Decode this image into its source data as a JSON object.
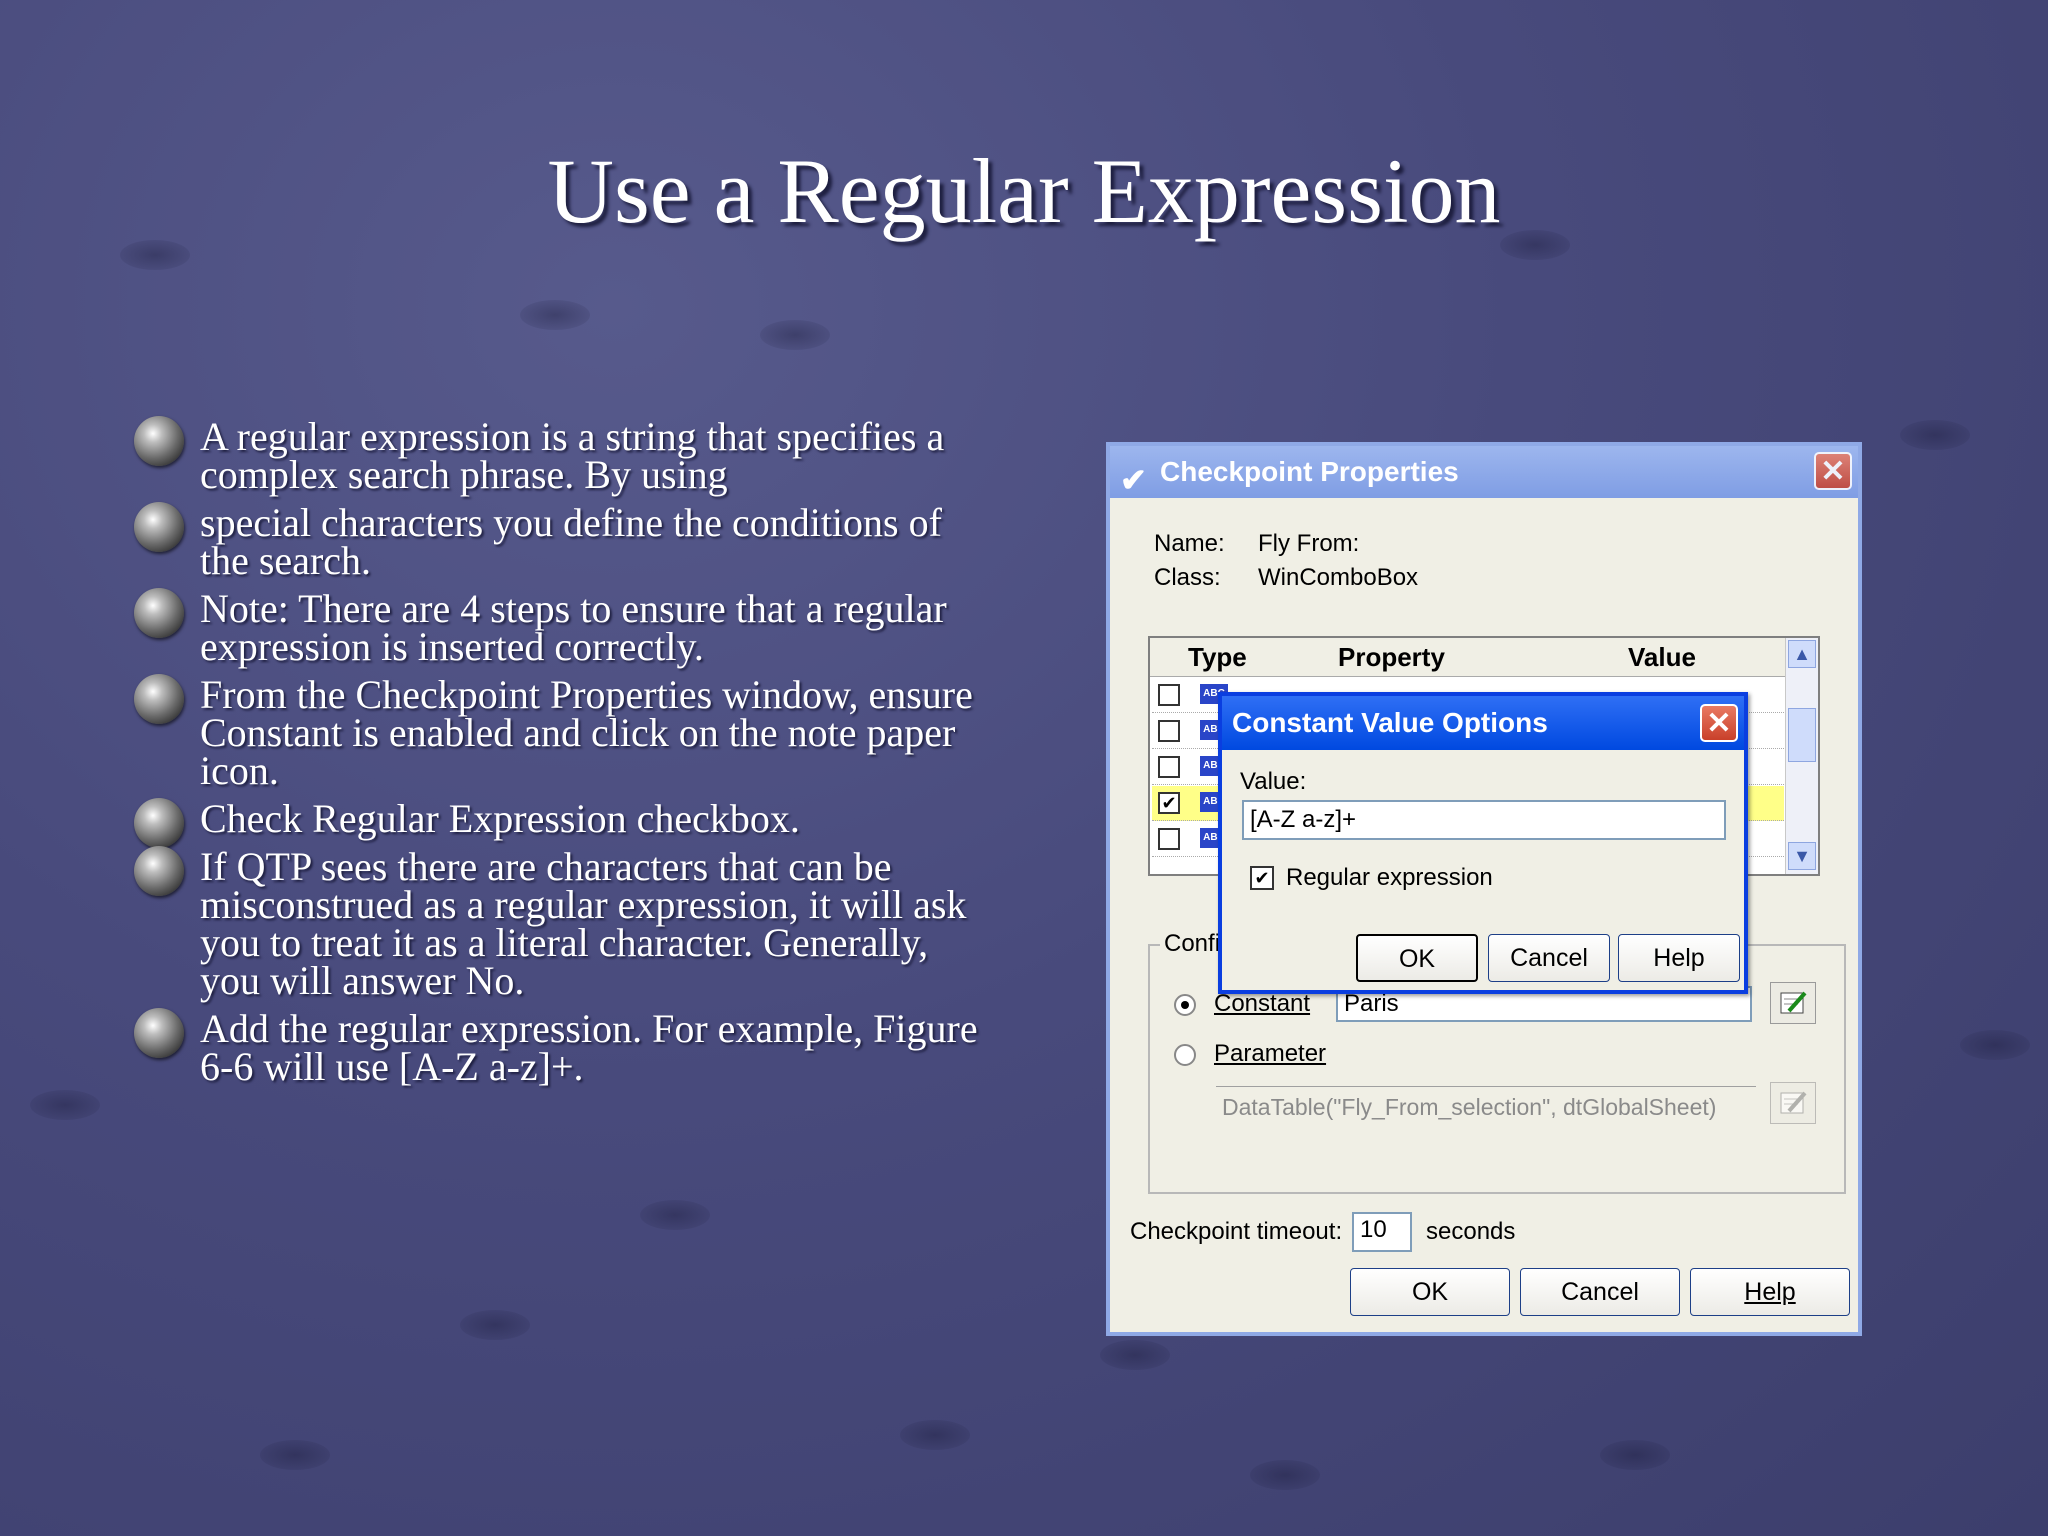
{
  "slide": {
    "title": "Use a Regular Expression",
    "bullets": [
      "A regular expression is a string that specifies a complex search phrase. By using",
      "special characters you define the conditions of the search.",
      "Note: There are 4 steps to ensure that a regular expression is inserted correctly.",
      "From the Checkpoint Properties window, ensure Constant is enabled and click on the note paper icon.",
      "Check Regular Expression checkbox.",
      "If  QTP sees there are characters that can be misconstrued as a regular expression, it will ask you to treat it as a literal character. Generally, you will answer No.",
      "Add the regular expression. For example, Figure 6-6 will use [A-Z a-z]+."
    ]
  },
  "checkpoint_dialog": {
    "title": "Checkpoint Properties",
    "name_label": "Name:",
    "name_value": "Fly From:",
    "class_label": "Class:",
    "class_value": "WinComboBox",
    "grid": {
      "col_type": "Type",
      "col_property": "Property",
      "col_value": "Value",
      "rows_checked": [
        false,
        false,
        false,
        true,
        false
      ],
      "type_icon": "ABC"
    },
    "config_label": "Confi",
    "constant_label": "Constant",
    "constant_value": "Paris",
    "parameter_label": "Parameter",
    "parameter_value": "DataTable(\"Fly_From_selection\", dtGlobalSheet)",
    "timeout_label": "Checkpoint timeout:",
    "timeout_value": "10",
    "timeout_unit": "seconds",
    "ok": "OK",
    "cancel": "Cancel",
    "help": "Help",
    "close_glyph": "✕",
    "check_glyph": "✔"
  },
  "constant_dialog": {
    "title": "Constant Value Options",
    "value_label": "Value:",
    "value": "[A-Z a-z]+",
    "regex_label": "Regular expression",
    "regex_checked": true,
    "ok": "OK",
    "cancel": "Cancel",
    "help": "Help",
    "close_glyph": "✕"
  },
  "colors": {
    "background": "#484a7c",
    "xp_title_active": "#0049e0",
    "xp_title_inactive": "#9db6ee",
    "highlight_row": "#ffff88"
  }
}
